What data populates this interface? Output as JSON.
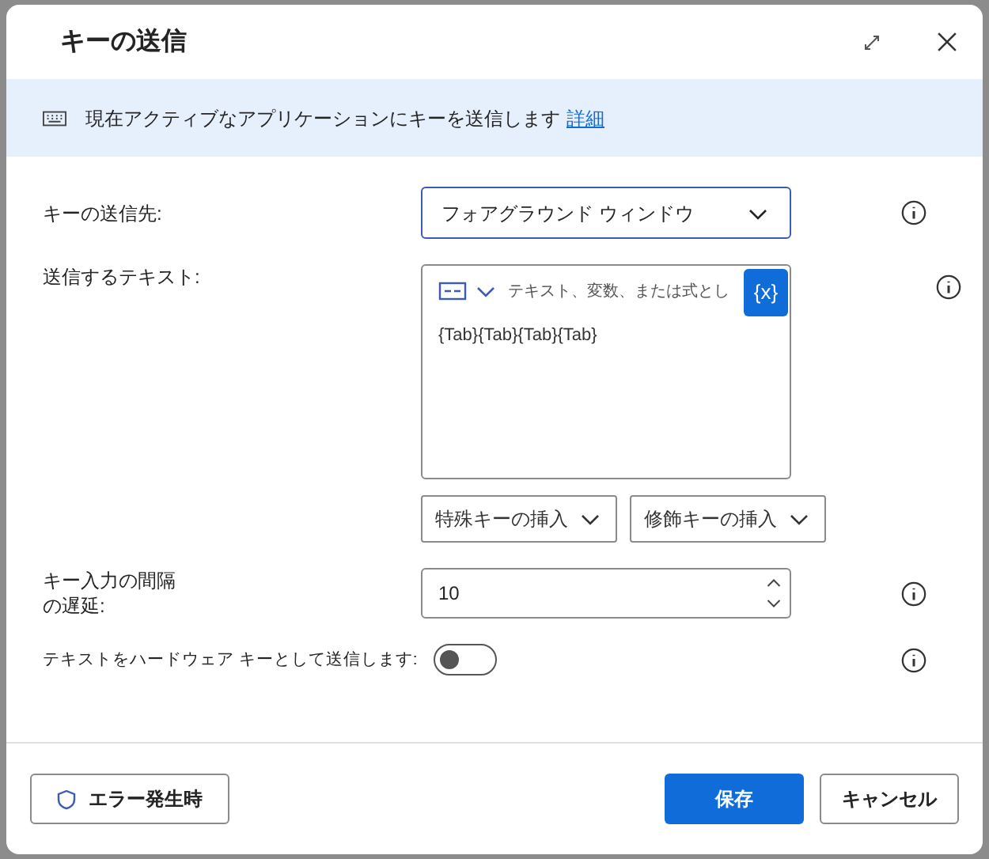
{
  "dialog": {
    "title": "キーの送信"
  },
  "banner": {
    "text": "現在アクティブなアプリケーションにキーを送信します",
    "link": "詳細"
  },
  "fields": [
    {
      "kind": "select",
      "label": "キーの送信先:",
      "value": "フォアグラウンド ウィンドウ"
    },
    {
      "kind": "textarea",
      "label": "送信するテキスト:",
      "placeholder": "テキスト、変数、または式とし",
      "value": "{Tab}{Tab}{Tab}{Tab}",
      "variable_button": "{x}",
      "insert_buttons": [
        "特殊キーの挿入",
        "修飾キーの挿入"
      ]
    },
    {
      "kind": "number",
      "label": "キー入力の間隔の遅延:",
      "value": "10"
    },
    {
      "kind": "toggle",
      "label": "テキストをハードウェア キーとして送信します:",
      "on": false
    }
  ],
  "footer": {
    "error_button": "エラー発生時",
    "save_button": "保存",
    "cancel_button": "キャンセル"
  }
}
